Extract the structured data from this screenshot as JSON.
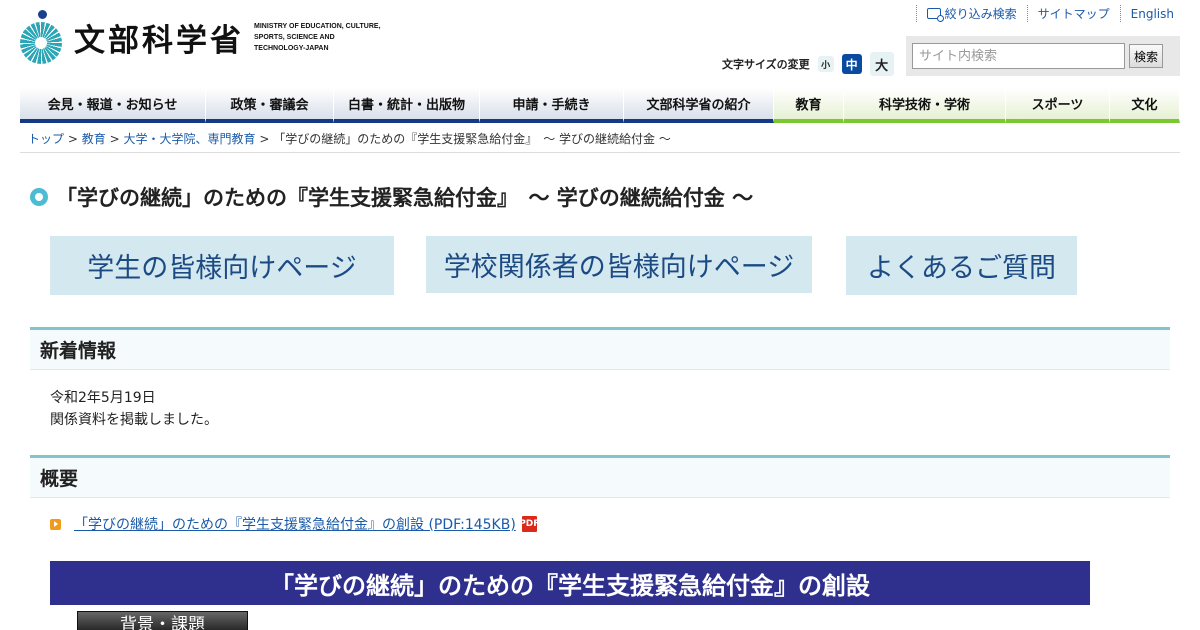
{
  "logo": {
    "name": "文部科学省",
    "english": "MINISTRY OF EDUCATION, CULTURE, SPORTS, SCIENCE AND TECHNOLOGY-JAPAN"
  },
  "utility_links": [
    {
      "label": "絞り込み検索",
      "icon": "search-filter-icon"
    },
    {
      "label": "サイトマップ"
    },
    {
      "label": "English"
    }
  ],
  "font_size": {
    "label": "文字サイズの変更",
    "small": "小",
    "medium": "中",
    "large": "大",
    "selected": "中"
  },
  "search": {
    "placeholder": "サイト内検索",
    "button": "検索"
  },
  "global_nav": [
    "会見・報道・お知らせ",
    "政策・審議会",
    "白書・統計・出版物",
    "申請・手続き",
    "文部科学省の紹介",
    "教育",
    "科学技術・学術",
    "スポーツ",
    "文化"
  ],
  "breadcrumb": {
    "items": [
      "トップ",
      "教育",
      "大学・大学院、専門教育"
    ],
    "current": "「学びの継続」のための『学生支援緊急給付金』　～ 学びの継続給付金 ～",
    "separator": ">"
  },
  "page_title": "「学びの継続」のための『学生支援緊急給付金』　～ 学びの継続給付金 ～",
  "quick_links": [
    "学生の皆様向けページ",
    "学校関係者の皆様向けページ",
    "よくあるご質問"
  ],
  "news": {
    "heading": "新着情報",
    "date": "令和2年5月19日",
    "text": "関係資料を掲載しました。"
  },
  "overview": {
    "heading": "概要",
    "link_text": "「学びの継続」のための『学生支援緊急給付金』の創設 (PDF:145KB)",
    "pdf_icon": "PDF"
  },
  "banner": {
    "title": "「学びの継続」のための『学生支援緊急給付金』の創設",
    "tag": "背景・課題"
  },
  "colors": {
    "nav_blue": "#143a86",
    "nav_green": "#7cc832",
    "button_bg": "#d4e8ef",
    "banner_bg": "#2f2f8e",
    "section_border": "#7fc6cf"
  }
}
